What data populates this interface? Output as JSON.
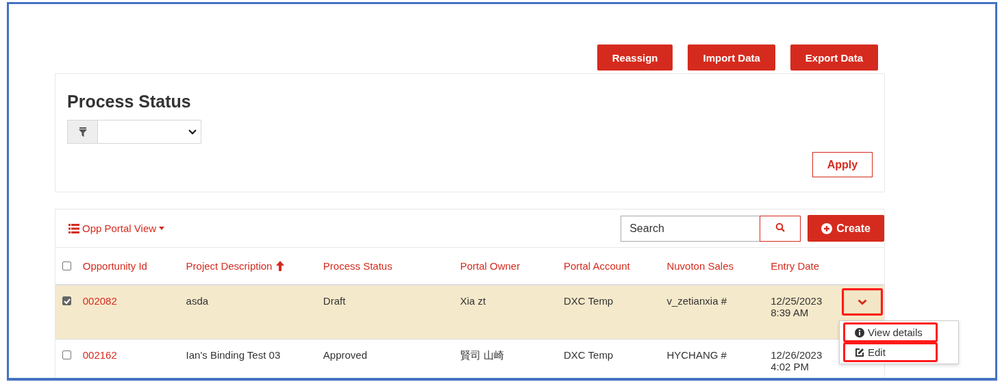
{
  "toolbar_buttons": [
    "Reassign",
    "Import Data",
    "Export Data"
  ],
  "filter_panel": {
    "title": "Process Status",
    "apply_button": "Apply"
  },
  "list_toolbar": {
    "view_menu": "Opp Portal View",
    "search": {
      "placeholder": "Search"
    },
    "create_button": "Create"
  },
  "table": {
    "select_all": {
      "checked": false
    },
    "columns": [
      {
        "label": "Opportunity Id",
        "sorted": false
      },
      {
        "label": "Project Description",
        "sorted": true
      },
      {
        "label": "Process Status",
        "sorted": false
      },
      {
        "label": "Portal Owner",
        "sorted": false
      },
      {
        "label": "Portal Account",
        "sorted": false
      },
      {
        "label": "Nuvoton Sales",
        "sorted": false
      },
      {
        "label": "Entry Date",
        "sorted": false
      }
    ],
    "rows": [
      {
        "checked": true,
        "selected": true,
        "cells": [
          "002082",
          "asda",
          "Draft",
          "Xia zt",
          "DXC Temp",
          "v_zetianxia #",
          "12/25/2023 8:39 AM"
        ],
        "actions": {
          "expanded": true,
          "highlighted": true
        }
      },
      {
        "checked": false,
        "selected": false,
        "cells": [
          "002162",
          "Ian's Binding Test 03",
          "Approved",
          "賢司 山崎",
          "DXC Temp",
          "HYCHANG #",
          "12/26/2023 4:02 PM"
        ]
      }
    ]
  },
  "row_menu": {
    "items": [
      {
        "kind": "info",
        "label": "View details",
        "highlighted": true
      },
      {
        "kind": "edit",
        "label": "Edit",
        "highlighted": true
      }
    ]
  }
}
